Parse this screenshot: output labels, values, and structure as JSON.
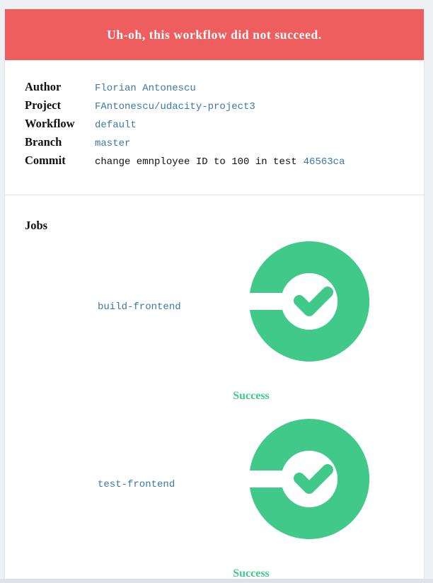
{
  "banner": {
    "title": "Uh-oh, this workflow did not succeed.",
    "color": "#ef5e5e"
  },
  "details": [
    {
      "label": "Author",
      "value": "Florian Antonescu"
    },
    {
      "label": "Project",
      "value": "FAntonescu/udacity-project3"
    },
    {
      "label": "Workflow",
      "value": "default"
    },
    {
      "label": "Branch",
      "value": "master"
    }
  ],
  "commit": {
    "label": "Commit",
    "message": "change emnployee ID to 100 in test",
    "hash": "46563ca"
  },
  "jobs": {
    "heading": "Jobs",
    "items": [
      {
        "name": "build-frontend",
        "status": "Success",
        "icon": "success-check-icon"
      },
      {
        "name": "test-frontend",
        "status": "Success",
        "icon": "success-check-icon"
      }
    ]
  },
  "colors": {
    "link": "#3b78a8",
    "success": "#41c98a"
  }
}
